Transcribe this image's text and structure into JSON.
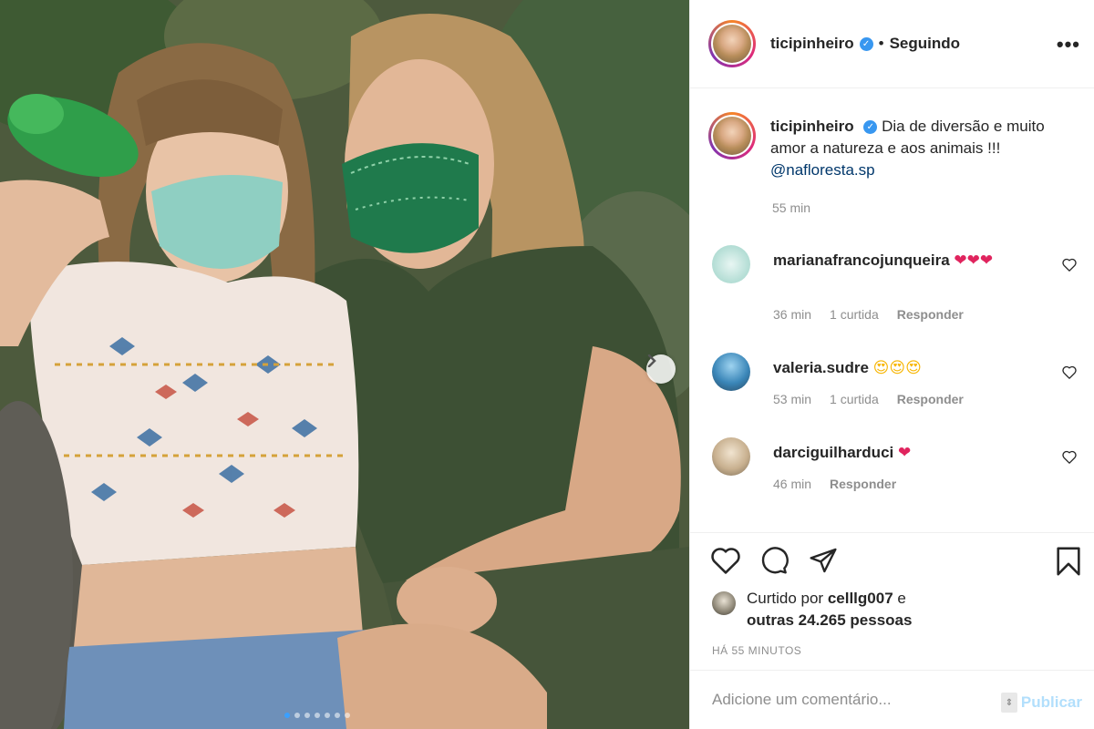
{
  "post": {
    "username": "ticipinheiro",
    "separator": "•",
    "follow_status": "Seguindo",
    "more_icon": "ellipsis-icon",
    "caption": {
      "text": "Dia de diversão e muito amor a natureza e aos animais !!! ",
      "mention": "@nafloresta.sp",
      "time": "55 min"
    },
    "carousel": {
      "total": 7,
      "current": 1
    }
  },
  "comments": [
    {
      "username": "marianafrancojunqueira",
      "text": "❤❤❤",
      "time": "36 min",
      "likes": "1 curtida",
      "reply": "Responder"
    },
    {
      "username": "valeria.sudre",
      "text": "😍😍😍",
      "time": "53 min",
      "likes": "1 curtida",
      "reply": "Responder"
    },
    {
      "username": "darciguilharduci",
      "text": "❤",
      "time": "46 min",
      "likes": "",
      "reply": "Responder"
    }
  ],
  "actions": {
    "like_icon": "heart-icon",
    "comment_icon": "comment-icon",
    "share_icon": "share-icon",
    "save_icon": "bookmark-icon"
  },
  "liked_by": {
    "prefix": "Curtido por ",
    "user": "celllg007",
    "joiner": " e ",
    "others": "outras 24.265 pessoas"
  },
  "posted_time": "HÁ 55 MINUTOS",
  "add_comment": {
    "placeholder": "Adicione um comentário...",
    "publish_label": "Publicar"
  },
  "colors": {
    "link": "#00376b",
    "verified": "#3897f0",
    "muted": "#8e8e8e",
    "publish_disabled": "#b2dffc"
  }
}
